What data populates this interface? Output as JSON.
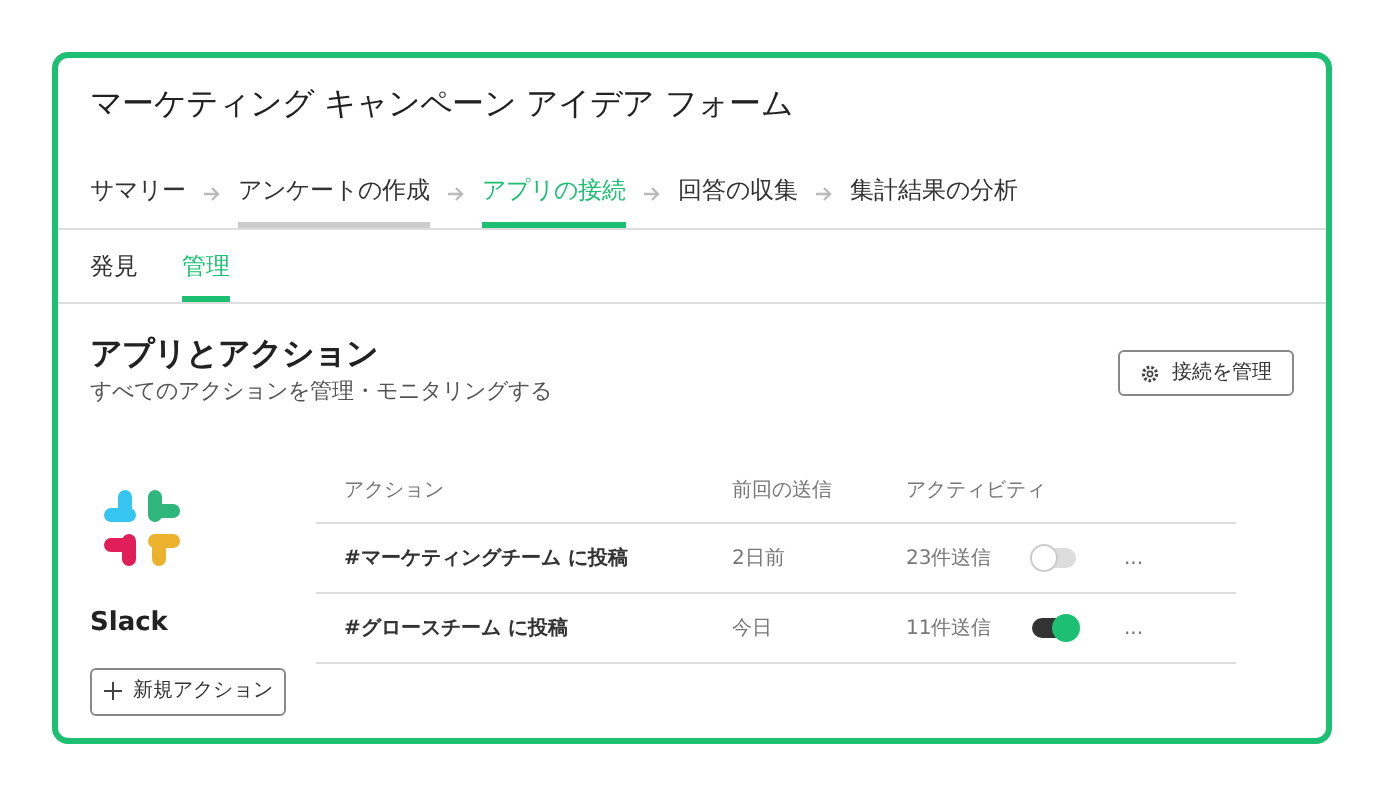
{
  "form_title": "マーケティング キャンペーン アイデア フォーム",
  "steps": [
    {
      "label": "サマリー",
      "selected": false,
      "kind": "plain"
    },
    {
      "label": "アンケートの作成",
      "selected": false,
      "kind": "visited"
    },
    {
      "label": "アプリの接続",
      "selected": true,
      "kind": "current"
    },
    {
      "label": "回答の収集",
      "selected": false,
      "kind": "plain"
    },
    {
      "label": "集計結果の分析",
      "selected": false,
      "kind": "plain"
    }
  ],
  "subtabs": [
    {
      "label": "発見",
      "selected": false
    },
    {
      "label": "管理",
      "selected": true
    }
  ],
  "section": {
    "title": "アプリとアクション",
    "subtitle": "すべてのアクションを管理・モニタリングする",
    "manage_button": "接続を管理"
  },
  "app": {
    "name": "Slack",
    "new_action_button": "新規アクション"
  },
  "table": {
    "columns": [
      "アクション",
      "前回の送信",
      "アクティビティ"
    ],
    "rows": [
      {
        "action": "#マーケティングチーム に投稿",
        "last_sent": "2日前",
        "activity": "23件送信",
        "on": false,
        "menu": "..."
      },
      {
        "action": "#グロースチーム に投稿",
        "last_sent": "今日",
        "activity": "11件送信",
        "on": true,
        "menu": "..."
      }
    ]
  }
}
